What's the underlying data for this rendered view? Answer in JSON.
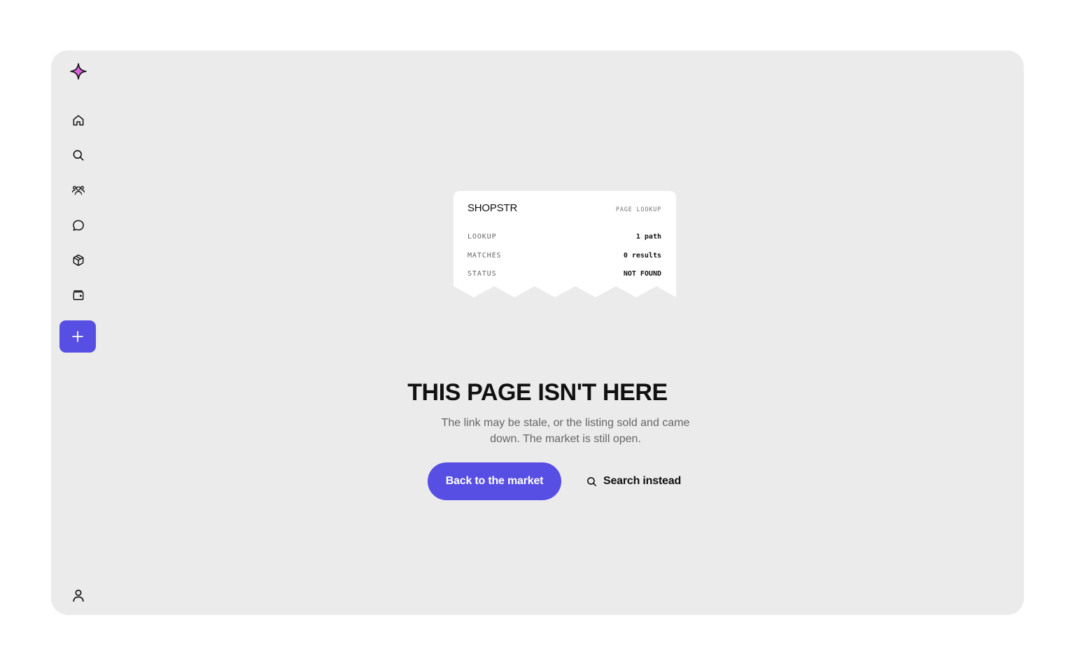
{
  "icons": {
    "logo": "sparkle-icon",
    "nav": [
      "home-icon",
      "search-icon",
      "community-icon",
      "chat-icon",
      "package-icon",
      "wallet-icon"
    ],
    "add": "plus-icon",
    "profile": "user-icon",
    "search_button": "search-icon"
  },
  "colors": {
    "accent": "#574ee3",
    "logo": "#d65fd9",
    "background": "#ebebeb"
  },
  "receipt": {
    "brand": "SHOPSTR",
    "tag": "PAGE LOOKUP",
    "rows": [
      {
        "key": "LOOKUP",
        "value": "1 path"
      },
      {
        "key": "MATCHES",
        "value": "0 results"
      },
      {
        "key": "STATUS",
        "value": "NOT FOUND"
      }
    ]
  },
  "main": {
    "title": "THIS PAGE ISN'T HERE",
    "subtitle": "The link may be stale, or the listing sold and came down. The market is still open.",
    "primary_button": "Back to the market",
    "secondary_button": "Search instead"
  }
}
